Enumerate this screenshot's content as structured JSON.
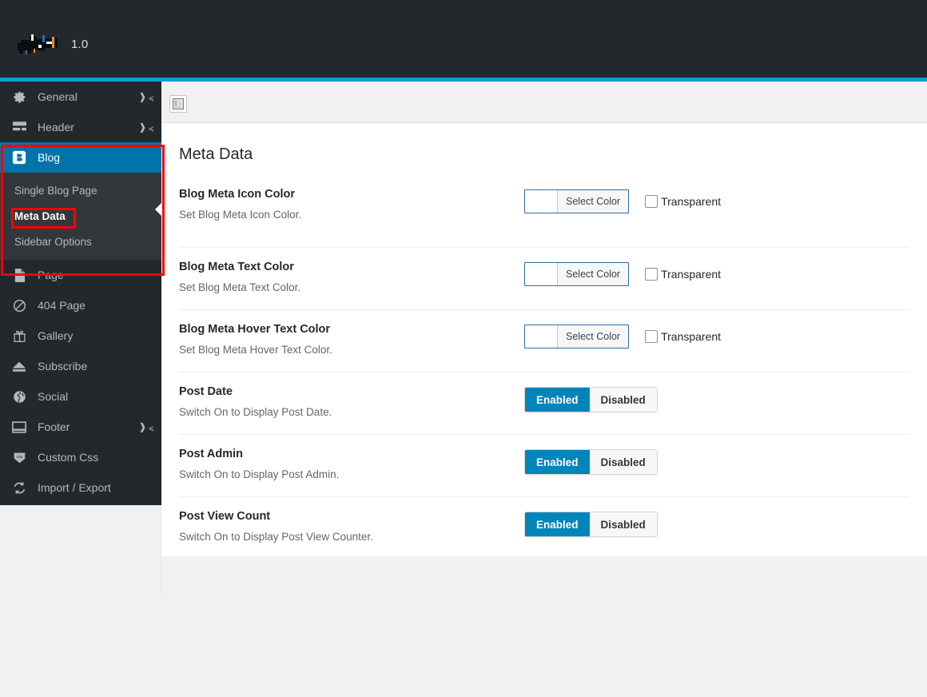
{
  "topbar": {
    "logo_name": "redacted-logo",
    "version": "1.0",
    "background": "#23282d",
    "accent": "#00a0d2"
  },
  "sidebar": {
    "active_color": "#0073aa",
    "background": "#23282d",
    "submenu_background": "#32373c",
    "items": [
      {
        "label": "General",
        "icon": "gear-icon",
        "expandable": true,
        "active": false
      },
      {
        "label": "Header",
        "icon": "header-icon",
        "expandable": true,
        "active": false
      },
      {
        "label": "Blog",
        "icon": "blog-icon",
        "expandable": true,
        "active": true
      },
      {
        "label": "Page",
        "icon": "page-icon",
        "expandable": false,
        "active": false
      },
      {
        "label": "404 Page",
        "icon": "forbidden-icon",
        "expandable": false,
        "active": false
      },
      {
        "label": "Gallery",
        "icon": "gift-icon",
        "expandable": false,
        "active": false
      },
      {
        "label": "Subscribe",
        "icon": "eject-icon",
        "expandable": false,
        "active": false
      },
      {
        "label": "Social",
        "icon": "globe-icon",
        "expandable": false,
        "active": false
      },
      {
        "label": "Footer",
        "icon": "footer-icon",
        "expandable": true,
        "active": false
      },
      {
        "label": "Custom Css",
        "icon": "css-shield-icon",
        "expandable": false,
        "active": false
      },
      {
        "label": "Import / Export",
        "icon": "sync-icon",
        "expandable": false,
        "active": false
      }
    ],
    "submenu": [
      {
        "label": "Single Blog Page",
        "current": false
      },
      {
        "label": "Meta Data",
        "current": true
      },
      {
        "label": "Sidebar Options",
        "current": false
      }
    ]
  },
  "toolbar": {
    "toggle_icon": "sidebar-layout-icon"
  },
  "panel": {
    "title": "Meta Data",
    "rows": [
      {
        "title": "Blog Meta Icon Color",
        "desc": "Set Blog Meta Icon Color.",
        "control": "color",
        "select_label": "Select Color",
        "swatch": "#ffffff",
        "transparent_label": "Transparent",
        "transparent_checked": false
      },
      {
        "title": "Blog Meta Text Color",
        "desc": "Set Blog Meta Text Color.",
        "control": "color",
        "select_label": "Select Color",
        "swatch": "#ffffff",
        "transparent_label": "Transparent",
        "transparent_checked": false
      },
      {
        "title": "Blog Meta Hover Text Color",
        "desc": "Set Blog Meta Hover Text Color.",
        "control": "color",
        "select_label": "Select Color",
        "swatch": "#ffffff",
        "transparent_label": "Transparent",
        "transparent_checked": false
      },
      {
        "title": "Post Date",
        "desc": "Switch On to Display Post Date.",
        "control": "switch",
        "on_label": "Enabled",
        "off_label": "Disabled",
        "value": "Enabled"
      },
      {
        "title": "Post Admin",
        "desc": "Switch On to Display Post Admin.",
        "control": "switch",
        "on_label": "Enabled",
        "off_label": "Disabled",
        "value": "Enabled"
      },
      {
        "title": "Post View Count",
        "desc": "Switch On to Display Post View Counter.",
        "control": "switch",
        "on_label": "Enabled",
        "off_label": "Disabled",
        "value": "Enabled"
      }
    ]
  },
  "annotations": {
    "color": "#fe0000",
    "boxes": [
      {
        "name": "blog-menu-group-highlight"
      },
      {
        "name": "meta-data-item-highlight"
      }
    ]
  }
}
